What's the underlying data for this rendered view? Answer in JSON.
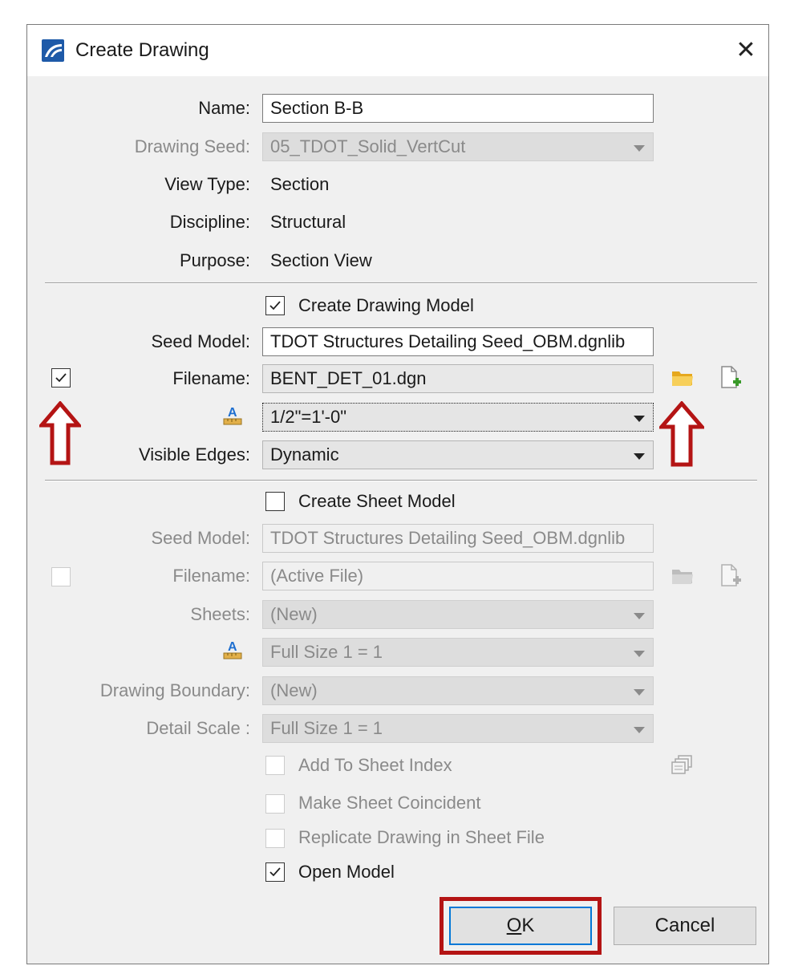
{
  "dialog": {
    "title": "Create Drawing",
    "close_glyph": "✕"
  },
  "fields": {
    "name_label": "Name:",
    "name_value": "Section B-B",
    "drawing_seed_label": "Drawing Seed:",
    "drawing_seed_value": "05_TDOT_Solid_VertCut",
    "view_type_label": "View Type:",
    "view_type_value": "Section",
    "discipline_label": "Discipline:",
    "discipline_value": "Structural",
    "purpose_label": "Purpose:",
    "purpose_value": "Section View"
  },
  "drawing_model": {
    "create_label": "Create Drawing Model",
    "create_checked": true,
    "seed_model_label": "Seed Model:",
    "seed_model_value": "TDOT Structures Detailing Seed_OBM.dgnlib",
    "filename_checked": true,
    "filename_label": "Filename:",
    "filename_value": "BENT_DET_01.dgn",
    "annotation_scale_value": "1/2\"=1'-0\"",
    "visible_edges_label": "Visible Edges:",
    "visible_edges_value": "Dynamic"
  },
  "sheet_model": {
    "create_label": "Create Sheet Model",
    "create_checked": false,
    "seed_model_label": "Seed Model:",
    "seed_model_value": "TDOT Structures Detailing Seed_OBM.dgnlib",
    "filename_label": "Filename:",
    "filename_value": "(Active File)",
    "sheets_label": "Sheets:",
    "sheets_value": "(New)",
    "annotation_scale_value": "Full Size 1 = 1",
    "drawing_boundary_label": "Drawing Boundary:",
    "drawing_boundary_value": "(New)",
    "detail_scale_label": "Detail Scale :",
    "detail_scale_value": "Full Size 1 = 1"
  },
  "options": {
    "add_to_sheet_index": "Add To Sheet Index",
    "make_sheet_coincident": "Make Sheet Coincident",
    "replicate_drawing": "Replicate Drawing in Sheet File",
    "open_model": "Open Model",
    "open_model_checked": true
  },
  "buttons": {
    "ok_mnemonic": "O",
    "ok_rest": "K",
    "cancel": "Cancel"
  },
  "colors": {
    "annotation_red": "#b41414",
    "dialog_bg": "#f0f0f0",
    "focus_blue": "#0078d7",
    "folder_yellow": "#f2c14e"
  },
  "icons": {
    "app": "microstation-icon",
    "annotation_scale": "annotation-scale-icon",
    "browse": "folder-open-icon",
    "new_file": "new-file-icon",
    "sheet_index": "sheet-index-icon"
  }
}
